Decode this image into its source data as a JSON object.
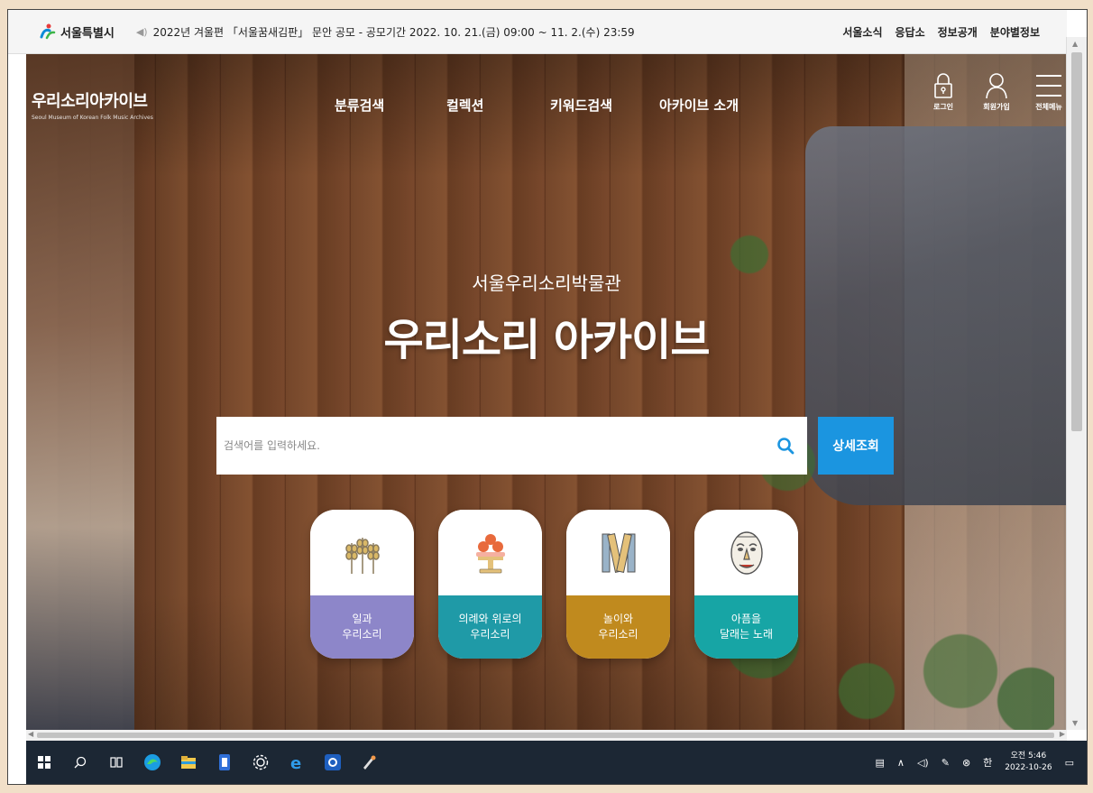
{
  "seoul_bar": {
    "logo_text": "서울특별시",
    "notice": "2022년 겨울편 「서울꿈새김판」 문안 공모 - 공모기간 2022. 10. 21.(금) 09:00 ~ 11. 2.(수) 23:59",
    "links": [
      "서울소식",
      "응답소",
      "정보공개",
      "분야별정보"
    ]
  },
  "site": {
    "logo_name": "우리소리아카이브",
    "logo_sub": "Seoul Museum of Korean Folk Music Archives"
  },
  "nav": [
    "분류검색",
    "컬렉션",
    "키워드검색",
    "아카이브 소개"
  ],
  "util": {
    "login": "로그인",
    "join": "회원가입",
    "menu": "전체메뉴"
  },
  "hero": {
    "subtitle": "서울우리소리박물관",
    "title": "우리소리 아카이브"
  },
  "search": {
    "placeholder": "검색어를 입력하세요.",
    "detail_label": "상세조회"
  },
  "categories": [
    {
      "label1": "일과",
      "label2": "우리소리",
      "color": "#8d86c9",
      "icon": "wheat-icon"
    },
    {
      "label1": "의례와 위로의",
      "label2": "우리소리",
      "color": "#1f9aa7",
      "icon": "offering-icon"
    },
    {
      "label1": "놀이와",
      "label2": "우리소리",
      "color": "#c08a1e",
      "icon": "yut-sticks-icon"
    },
    {
      "label1": "아픔을",
      "label2": "달래는 노래",
      "color": "#17a5a5",
      "icon": "mask-icon"
    }
  ],
  "taskbar": {
    "clock_time": "오전 5:46",
    "clock_date": "2022-10-26",
    "ime": "한"
  },
  "colors": {
    "accent": "#1b95e0",
    "taskbar": "#1c2734"
  }
}
